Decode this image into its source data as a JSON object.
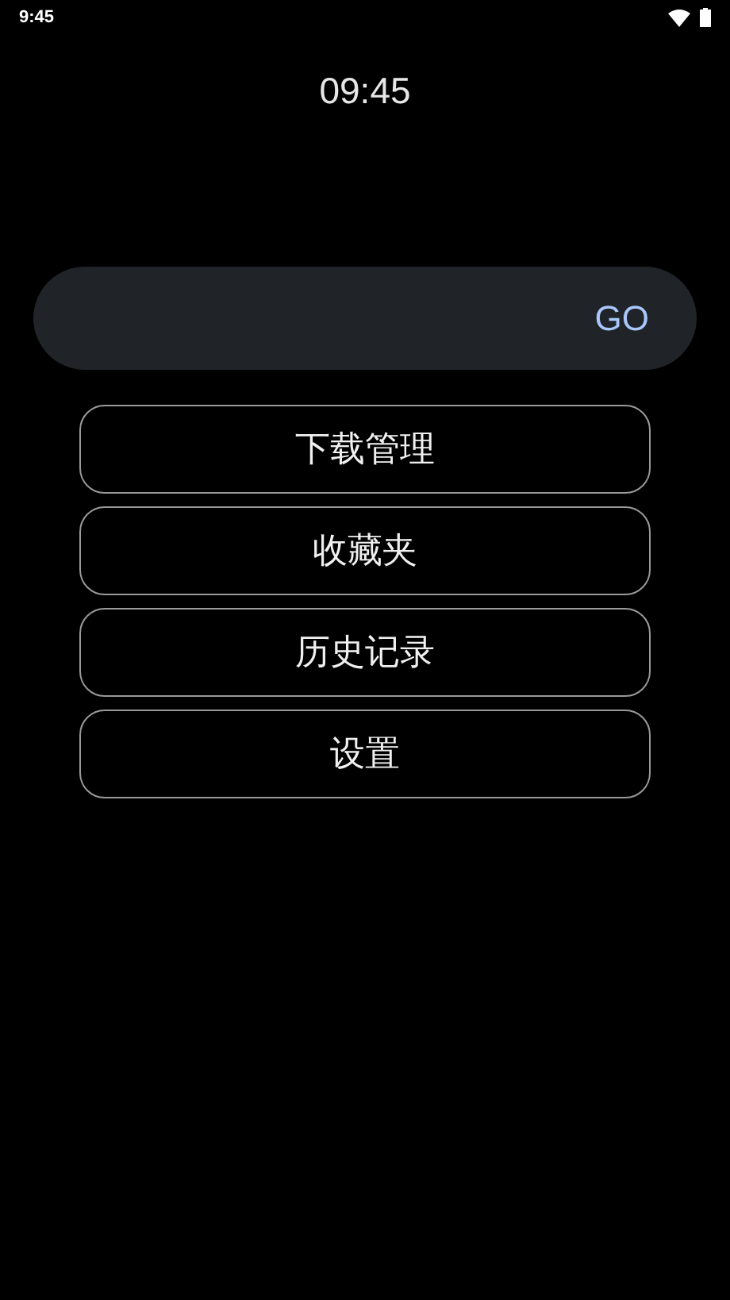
{
  "status_bar": {
    "time": "9:45"
  },
  "clock": "09:45",
  "search": {
    "button": "GO"
  },
  "menu": [
    {
      "label": "下载管理"
    },
    {
      "label": "收藏夹"
    },
    {
      "label": "历史记录"
    },
    {
      "label": "设置"
    }
  ]
}
